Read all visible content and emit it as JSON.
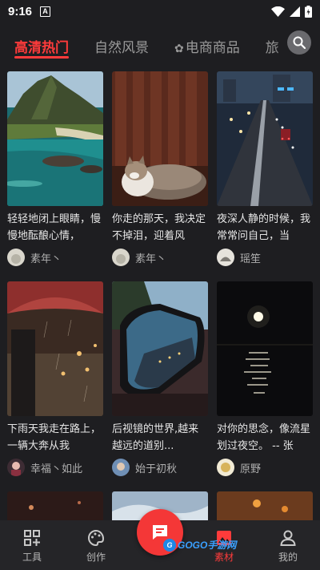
{
  "status": {
    "time": "9:16",
    "notif_glyph": "A"
  },
  "tabs": [
    {
      "label": "高清热门",
      "active": true
    },
    {
      "label": "自然风景",
      "active": false
    },
    {
      "label": "电商商品",
      "active": false,
      "icon": "flower-icon"
    },
    {
      "label": "旅",
      "active": false
    }
  ],
  "cards": [
    {
      "caption": "轻轻地闭上眼睛，慢慢地酝酿心情，",
      "author": "素年丶"
    },
    {
      "caption": "你走的那天，我决定不掉泪，迎着风",
      "author": "素年丶"
    },
    {
      "caption": "夜深人静的时候，我常常问自己，当",
      "author": "瑶笙"
    },
    {
      "caption": "下雨天我走在路上，一辆大奔从我",
      "author": "幸福丶如此"
    },
    {
      "caption": "后视镜的世界,越来越远的道别...",
      "author": "始于初秋"
    },
    {
      "caption": "对你的思念，像流星划过夜空。 -- 张",
      "author": "原野"
    }
  ],
  "nav": {
    "tools": "工具",
    "create": "创作",
    "material": "素材",
    "mine": "我的"
  },
  "watermark": "GOGO手游网",
  "colors": {
    "accent": "#ff3b3b",
    "background": "#1e1e21",
    "nav_bg": "#252528"
  }
}
